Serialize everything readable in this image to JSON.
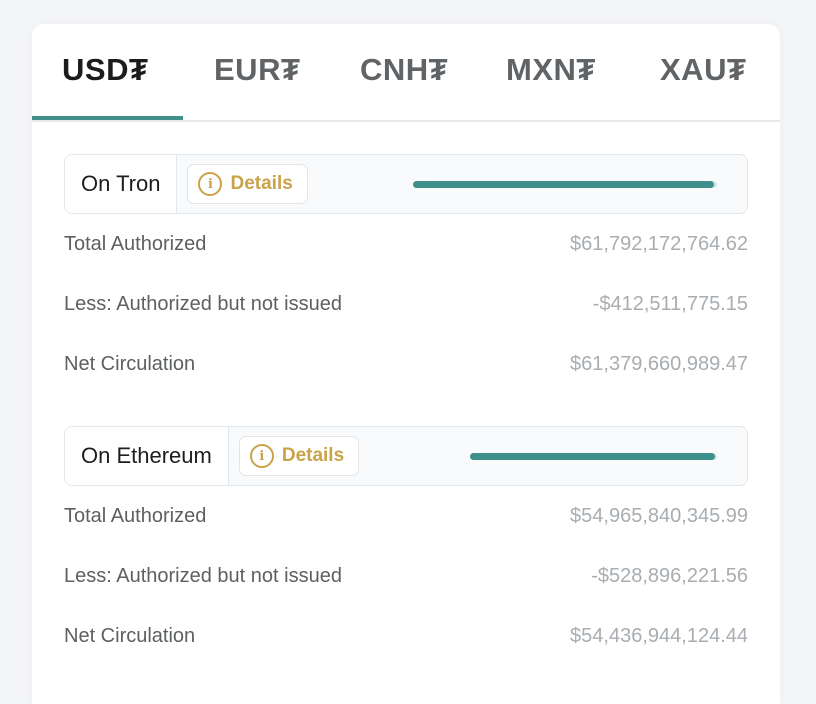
{
  "tabs": [
    {
      "label": "USD₮",
      "active": true
    },
    {
      "label": "EUR₮",
      "active": false
    },
    {
      "label": "CNH₮",
      "active": false
    },
    {
      "label": "MXN₮",
      "active": false
    },
    {
      "label": "XAU₮",
      "active": false
    }
  ],
  "details_label": "Details",
  "colors": {
    "accent": "#3f8f8a",
    "gold": "#c9a24a"
  },
  "chains": [
    {
      "name": "On Tron",
      "progress_fraction": 0.99,
      "rows": [
        {
          "label": "Total Authorized",
          "value": "$61,792,172,764.62"
        },
        {
          "label": "Less: Authorized but not issued",
          "value": "-$412,511,775.15"
        },
        {
          "label": "Net Circulation",
          "value": "$61,379,660,989.47"
        }
      ]
    },
    {
      "name": "On Ethereum",
      "progress_fraction": 0.99,
      "rows": [
        {
          "label": "Total Authorized",
          "value": "$54,965,840,345.99"
        },
        {
          "label": "Less: Authorized but not issued",
          "value": "-$528,896,221.56"
        },
        {
          "label": "Net Circulation",
          "value": "$54,436,944,124.44"
        }
      ]
    }
  ]
}
